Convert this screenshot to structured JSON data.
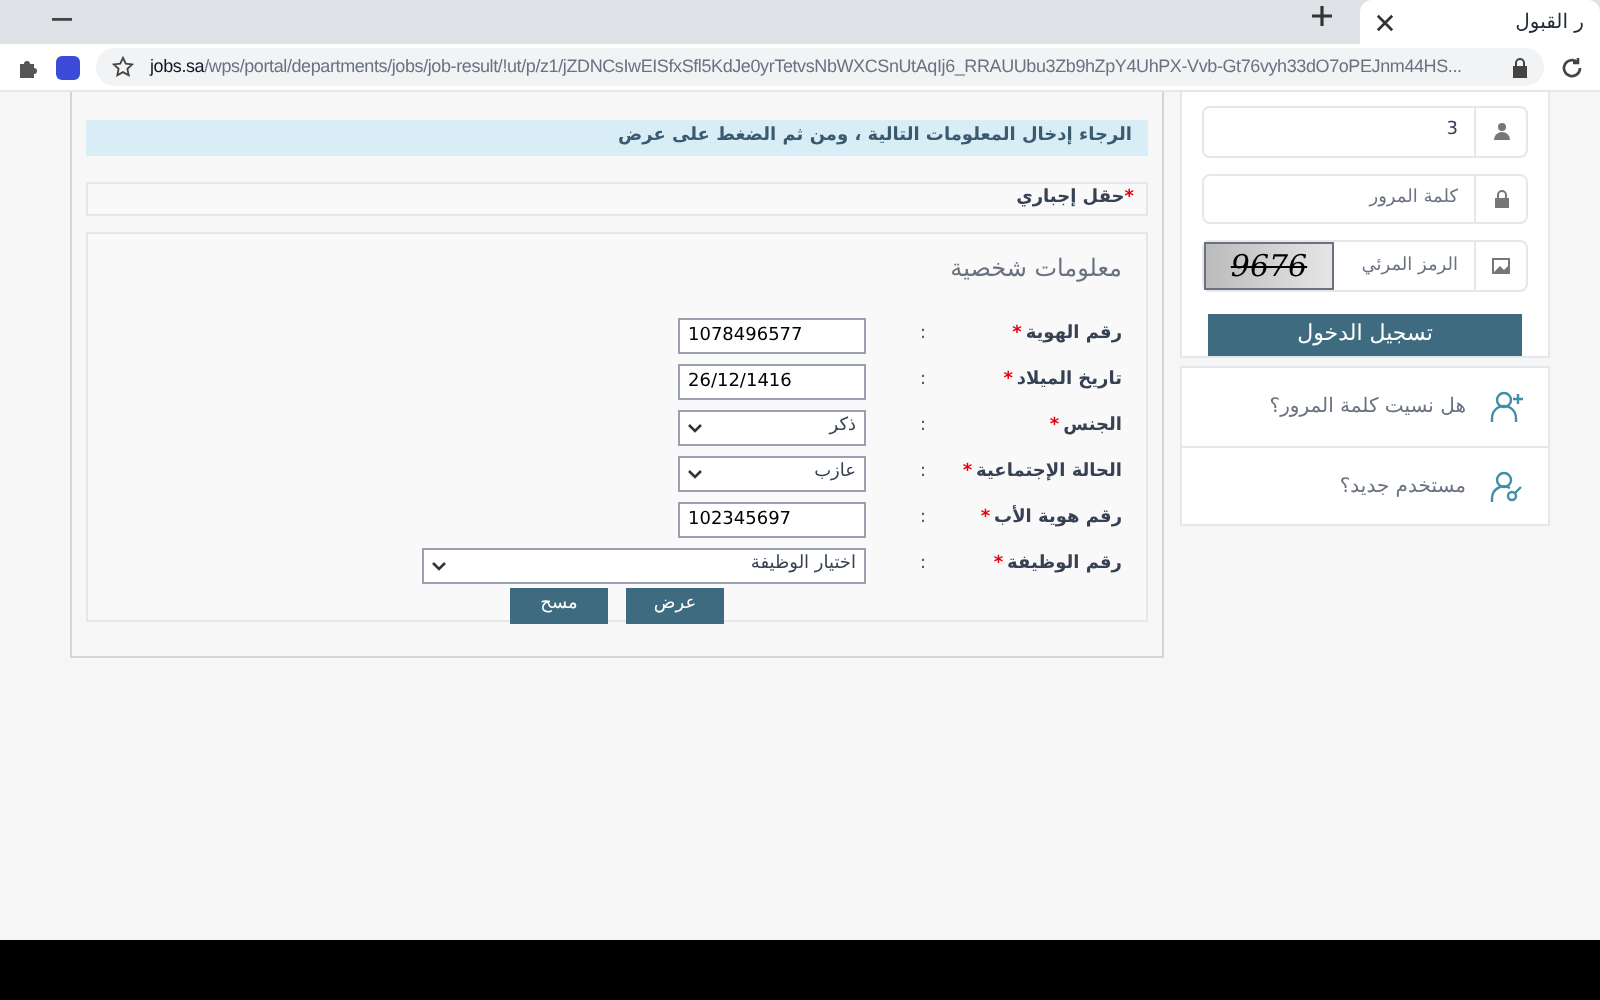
{
  "browser": {
    "tab_title": "ر القبول",
    "url_host": "jobs.sa",
    "url_path": "/wps/portal/departments/jobs/job-result/!ut/p/z1/jZDNCsIwEISfxSfl5KdJe0yrTetvsNbWXCSnUtAqIj6_RRAUUbu3Zb9hZpY4UhPX-Vvb-Gt76vyh33dO7oPEJnm44HS..."
  },
  "info_message": "الرجاء إدخال المعلومات التالية ، ومن ثم الضغط على عرض",
  "required_note": "حقل إجباري",
  "asterisk": "*",
  "section_title": "معلومات شخصية",
  "fields": [
    {
      "label": "رقم الهوية",
      "kind": "text",
      "value": "1078496577",
      "wide": false
    },
    {
      "label": "تاريخ الميلاد",
      "kind": "text",
      "value": "26/12/1416",
      "wide": false
    },
    {
      "label": "الجنس",
      "kind": "select",
      "value": "ذكر",
      "wide": false
    },
    {
      "label": "الحالة الإجتماعية",
      "kind": "select",
      "value": "عازب",
      "wide": false
    },
    {
      "label": "رقم هوية الأب",
      "kind": "text",
      "value": "102345697",
      "wide": false
    },
    {
      "label": "رقم الوظيفة",
      "kind": "select",
      "value": "اختيار الوظيفة",
      "wide": true
    }
  ],
  "colon": ":",
  "buttons": [
    "عرض",
    "مسح"
  ],
  "login": {
    "username": "3",
    "password_placeholder": "كلمة المرور",
    "captcha_placeholder": "الرمز المرئي",
    "captcha": "9676",
    "submit": "تسجيل الدخول"
  },
  "links": [
    "هل نسيت كلمة المرور؟",
    "مستخدم جديد؟"
  ]
}
